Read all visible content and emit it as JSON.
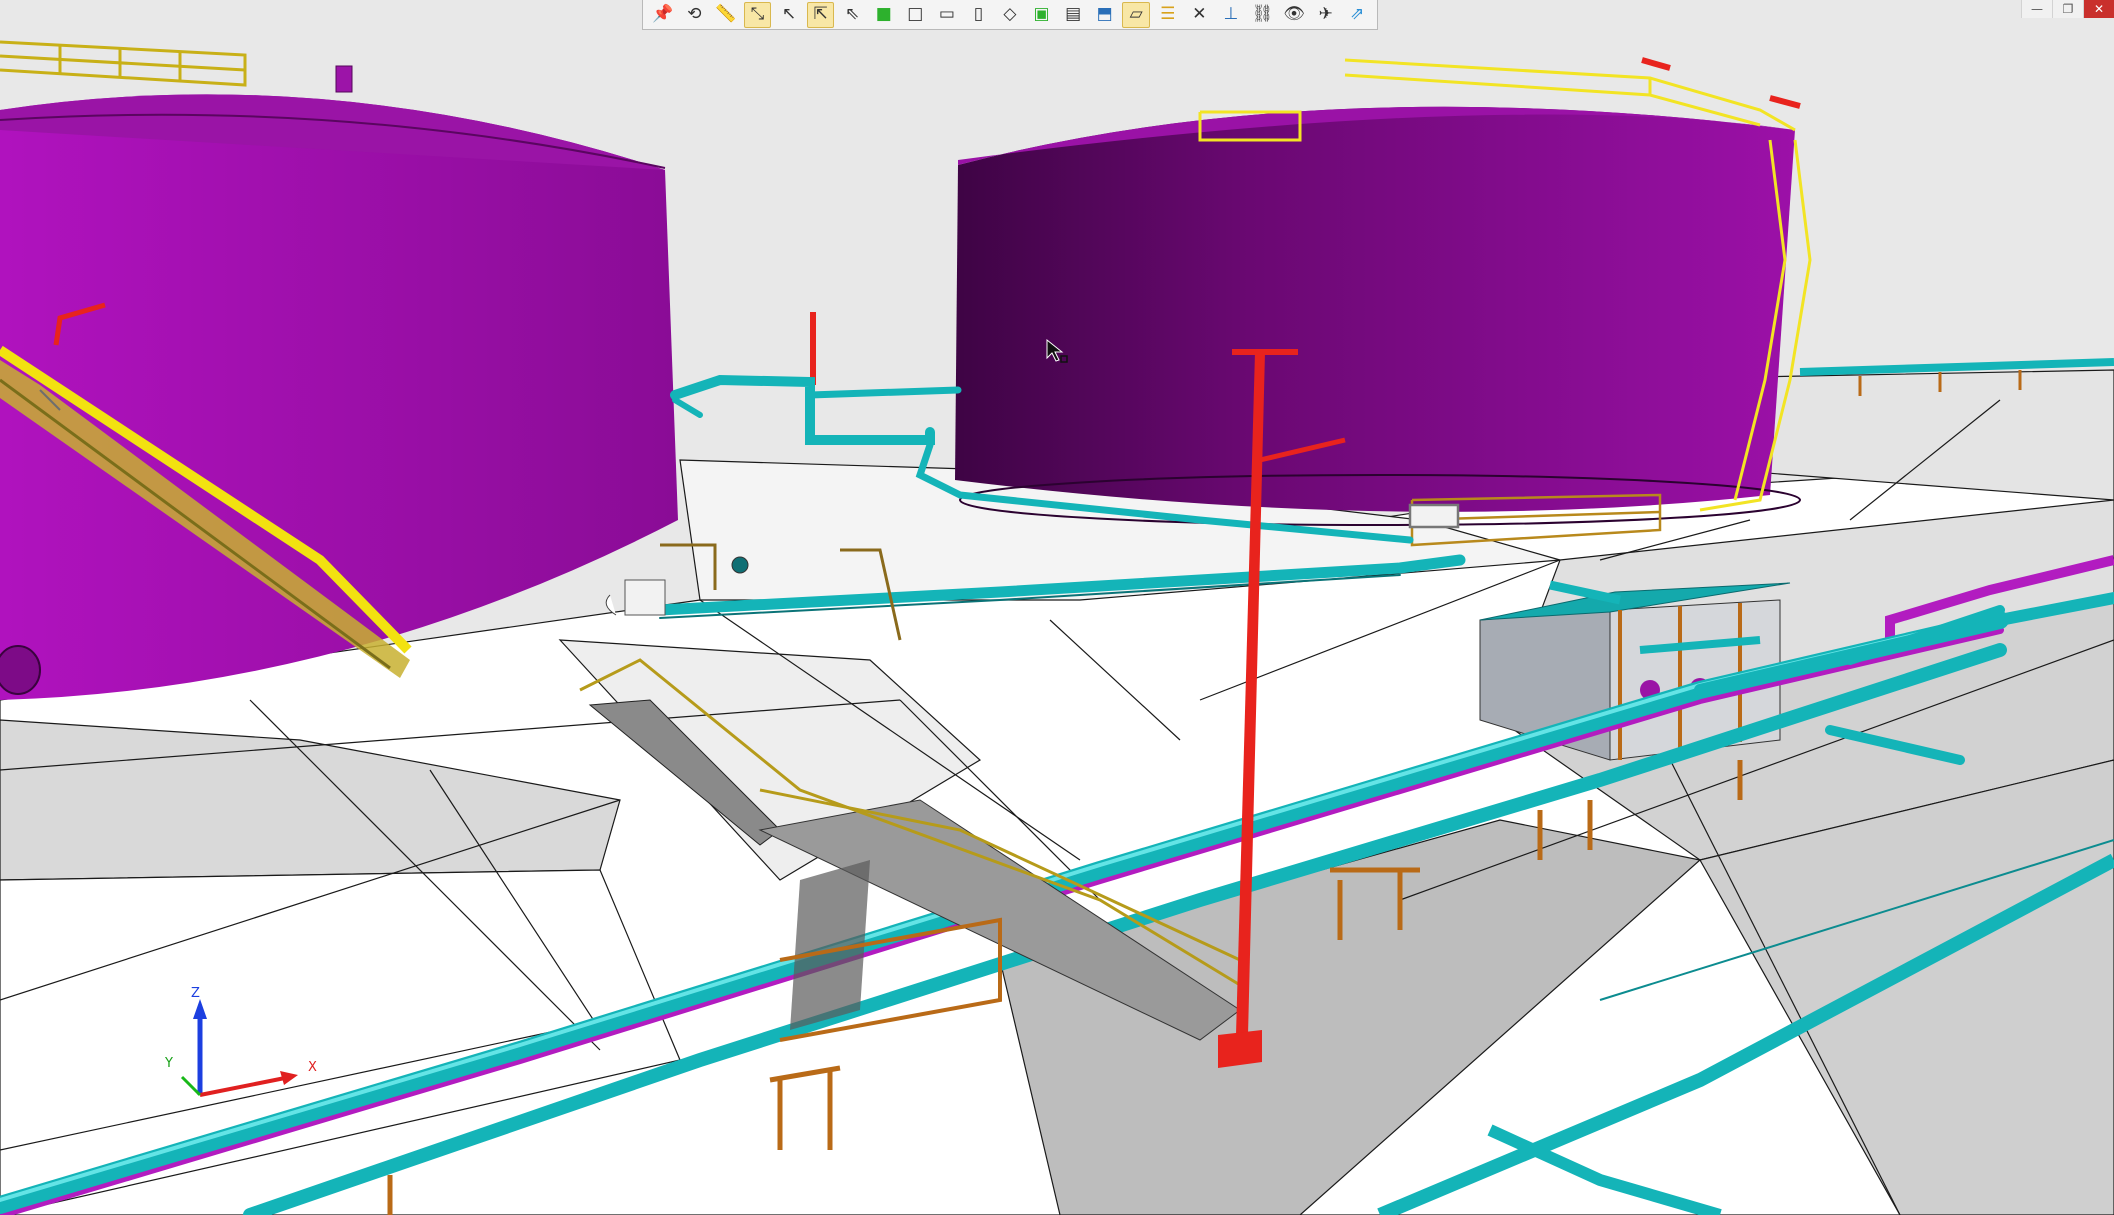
{
  "toolbar": {
    "buttons": [
      {
        "icon": "pin-icon",
        "glyph": "📌",
        "active": false
      },
      {
        "icon": "rotate-view-icon",
        "glyph": "⟲",
        "active": false
      },
      {
        "icon": "measure-ruler-icon",
        "glyph": "📏",
        "active": false
      },
      {
        "icon": "pick-point-icon",
        "glyph": "⤡",
        "active": true
      },
      {
        "icon": "pick-edge-icon",
        "glyph": "↖",
        "active": false
      },
      {
        "icon": "pick-face-icon",
        "glyph": "⇱",
        "active": true
      },
      {
        "icon": "select-cursor-icon",
        "glyph": "⇖",
        "active": false
      },
      {
        "icon": "view-front-icon",
        "glyph": "■",
        "active": false
      },
      {
        "icon": "view-back-icon",
        "glyph": "□",
        "active": false
      },
      {
        "icon": "view-left-icon",
        "glyph": "▭",
        "active": false
      },
      {
        "icon": "view-right-icon",
        "glyph": "▯",
        "active": false
      },
      {
        "icon": "view-iso-icon",
        "glyph": "◇",
        "active": false
      },
      {
        "icon": "view-select-icon",
        "glyph": "▣",
        "active": false
      },
      {
        "icon": "clip-box-icon",
        "glyph": "▤",
        "active": false
      },
      {
        "icon": "section-icon",
        "glyph": "⬒",
        "active": false
      },
      {
        "icon": "clip-plane-icon",
        "glyph": "⏥",
        "active": true
      },
      {
        "icon": "layer-stack-icon",
        "glyph": "☰",
        "active": false
      },
      {
        "icon": "clear-section-icon",
        "glyph": "✕",
        "active": false
      },
      {
        "icon": "axes-icon",
        "glyph": "⊥",
        "active": false
      },
      {
        "icon": "link-icon",
        "glyph": "⛓",
        "active": false
      },
      {
        "icon": "eye-icon",
        "glyph": "👁",
        "active": false
      },
      {
        "icon": "fly-mode-icon",
        "glyph": "✈",
        "active": false
      },
      {
        "icon": "export-icon",
        "glyph": "⇗",
        "active": false
      }
    ]
  },
  "window_controls": {
    "minimize": "—",
    "restore": "❐",
    "close": "✕"
  },
  "axis": {
    "x": "X",
    "y": "Y",
    "z": "Z"
  },
  "colors": {
    "background": "#e9e9e9",
    "ground": "#ffffff",
    "tank": "#8e1098",
    "tank_dark": "#4d0550",
    "pipe": "#14b4b8",
    "pipe_secondary": "#b21cc0",
    "pole": "#e8231d",
    "railing": "#f0e024",
    "support": "#b96a17"
  }
}
